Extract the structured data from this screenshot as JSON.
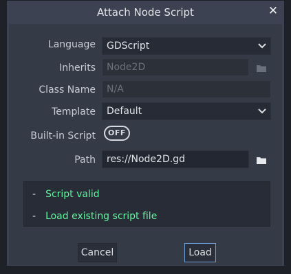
{
  "dialog": {
    "title": "Attach Node Script",
    "close_icon": "close-icon"
  },
  "form": {
    "language": {
      "label": "Language",
      "value": "GDScript"
    },
    "inherits": {
      "label": "Inherits",
      "value": "Node2D",
      "icon": "folder-icon"
    },
    "class_name": {
      "label": "Class Name",
      "placeholder": "N/A"
    },
    "template": {
      "label": "Template",
      "value": "Default"
    },
    "builtin_script": {
      "label": "Built-in Script",
      "toggle_text": "OFF",
      "enabled": false
    },
    "path": {
      "label": "Path",
      "value": "res://Node2D.gd",
      "icon": "folder-icon"
    }
  },
  "status": {
    "items": [
      {
        "bullet": "-",
        "text": "Script valid"
      },
      {
        "bullet": "-",
        "text": "Load existing script file"
      }
    ],
    "text_color": "#63f5a0"
  },
  "buttons": {
    "cancel": "Cancel",
    "load": "Load"
  },
  "colors": {
    "accent": "#6f9fd9",
    "background": "#3c4252"
  }
}
